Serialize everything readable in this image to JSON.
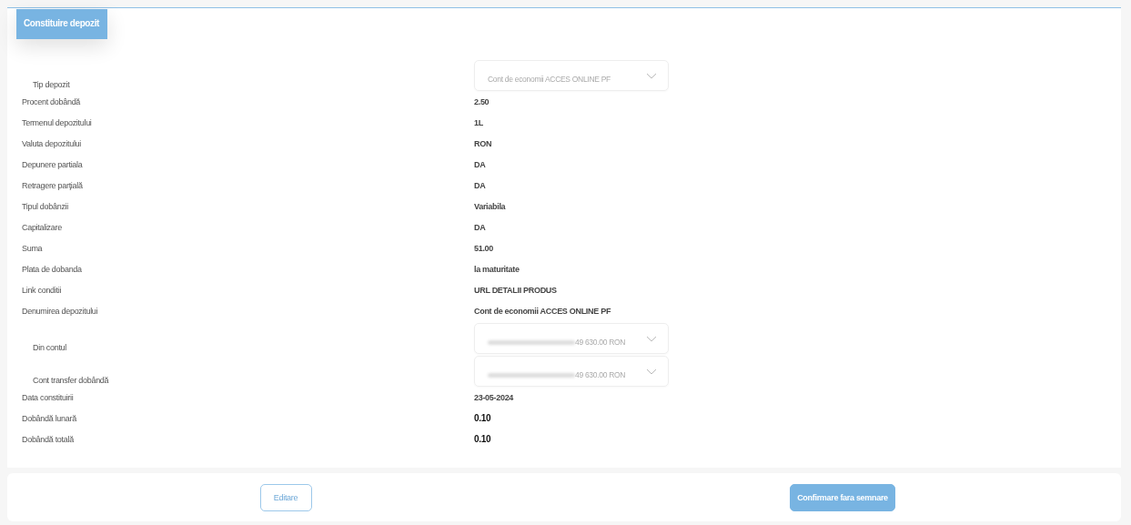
{
  "header": {
    "title": "Constituire depozit"
  },
  "rows": [
    {
      "kind": "select",
      "label": "Tip depozit",
      "value": "Cont de economii ACCES ONLINE PF",
      "redacted": false
    },
    {
      "kind": "text",
      "label": "Procent dobândă",
      "value": "2.50",
      "strong": false
    },
    {
      "kind": "text",
      "label": "Termenul depozitului",
      "value": "1L",
      "strong": false
    },
    {
      "kind": "text",
      "label": "Valuta depozitului",
      "value": "RON",
      "strong": false
    },
    {
      "kind": "text",
      "label": "Depunere partiala",
      "value": "DA",
      "strong": false
    },
    {
      "kind": "text",
      "label": "Retragere parţială",
      "value": "DA",
      "strong": false
    },
    {
      "kind": "text",
      "label": "Tipul dobânzii",
      "value": "Variabila",
      "strong": false
    },
    {
      "kind": "text",
      "label": "Capitalizare",
      "value": "DA",
      "strong": false
    },
    {
      "kind": "text",
      "label": "Suma",
      "value": "51.00",
      "strong": false
    },
    {
      "kind": "text",
      "label": "Plata de dobanda",
      "value": "la maturitate",
      "strong": false
    },
    {
      "kind": "text",
      "label": "Link conditii",
      "value": "URL DETALII PRODUS",
      "strong": false
    },
    {
      "kind": "text",
      "label": "Denumirea depozitului",
      "value": "Cont de economii ACCES ONLINE PF",
      "strong": false
    },
    {
      "kind": "select",
      "label": "Din contul",
      "value": "49 630.00 RON",
      "redacted": true
    },
    {
      "kind": "select",
      "label": "Cont transfer dobândă",
      "value": "49 630.00 RON",
      "redacted": true
    },
    {
      "kind": "text",
      "label": "Data constituirii",
      "value": "23-05-2024",
      "strong": false
    },
    {
      "kind": "text",
      "label": "Dobândă lunară",
      "value": "0.10",
      "strong": true
    },
    {
      "kind": "text",
      "label": "Dobândă totală",
      "value": "0.10",
      "strong": true
    }
  ],
  "actions": [
    {
      "kind": "secondary",
      "label": "Editare"
    },
    {
      "kind": "primary",
      "label": "Confirmare fara semnare"
    }
  ]
}
